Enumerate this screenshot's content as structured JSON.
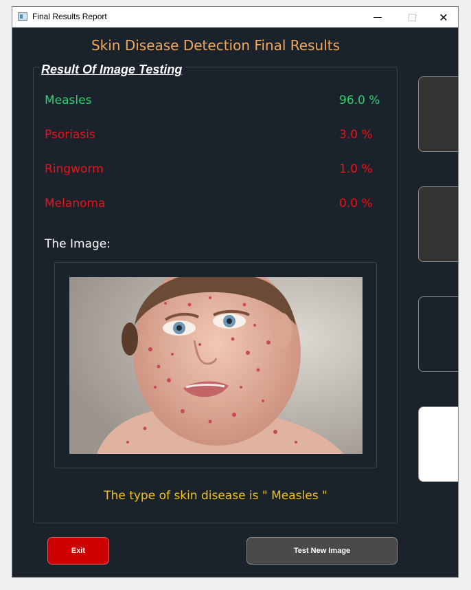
{
  "window": {
    "title": "Final Results Report",
    "controls": {
      "minimize": "—",
      "close": "✕"
    }
  },
  "header": {
    "title": "Skin Disease Detection Final Results"
  },
  "results_group": {
    "title": "Result Of Image Testing",
    "rows": [
      {
        "label": "Measles",
        "percent": "96.0 %",
        "color": "#2bd36b"
      },
      {
        "label": "Psoriasis",
        "percent": "3.0 %",
        "color": "#e8141a"
      },
      {
        "label": "Ringworm",
        "percent": "1.0 %",
        "color": "#e8141a"
      },
      {
        "label": "Melanoma",
        "percent": "0.0 %",
        "color": "#e8141a"
      }
    ],
    "image_label": "The Image:",
    "result_text": "The type of skin disease is \" Measles \""
  },
  "buttons": {
    "exit": "Exit",
    "test_new": "Test New Image"
  },
  "colors": {
    "background": "#1a222c",
    "header": "#f5a85a",
    "result_text": "#f2c11c",
    "exit_button": "#cc0000",
    "test_button": "#4a4a4a"
  },
  "side_cards": [
    {
      "fill": "#333333"
    },
    {
      "fill": "#333333"
    },
    {
      "fill": "#1a222c"
    },
    {
      "fill": "#ffffff"
    }
  ]
}
